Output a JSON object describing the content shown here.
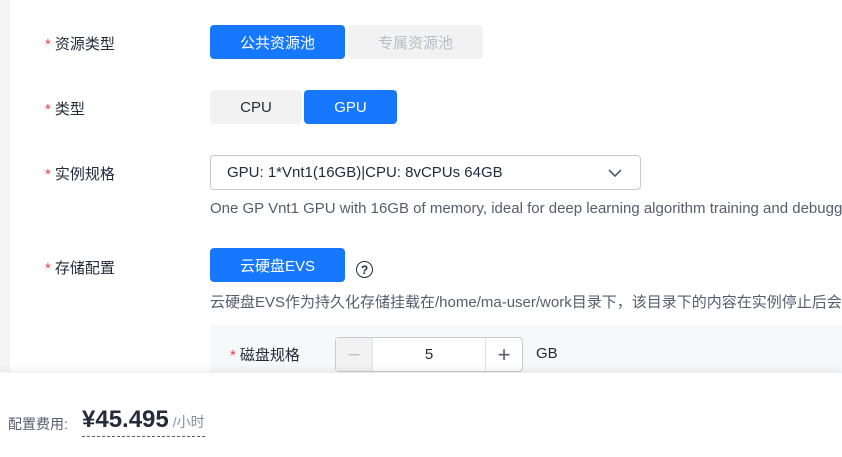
{
  "form": {
    "resource_type": {
      "label": "资源类型",
      "options": [
        "公共资源池",
        "专属资源池"
      ]
    },
    "type": {
      "label": "类型",
      "options": [
        "CPU",
        "GPU"
      ]
    },
    "instance_spec": {
      "label": "实例规格",
      "selected": "GPU: 1*Vnt1(16GB)|CPU: 8vCPUs 64GB",
      "description": "One GP Vnt1 GPU with 16GB of memory, ideal for deep learning algorithm training and debugg"
    },
    "storage": {
      "label": "存储配置",
      "option": "云硬盘EVS",
      "description": "云硬盘EVS作为持久化存储挂载在/home/ma-user/work目录下，该目录下的内容在实例停止后会",
      "disk": {
        "label": "磁盘规格",
        "value": "5",
        "unit": "GB"
      }
    }
  },
  "footer": {
    "fee_label": "配置费用:",
    "price": "¥45.495",
    "per": "/小时"
  },
  "colors": {
    "accent": "#1677ff",
    "required_star": "#e54545"
  }
}
